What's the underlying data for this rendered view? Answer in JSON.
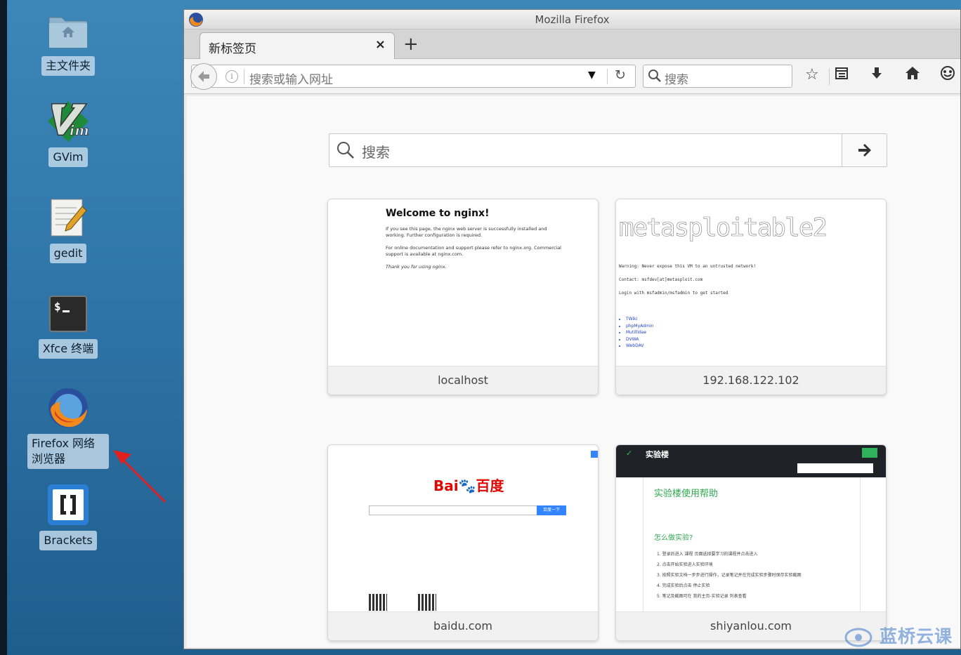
{
  "desktop": {
    "icons": [
      {
        "label": "主文件夹"
      },
      {
        "label": "GVim"
      },
      {
        "label": "gedit"
      },
      {
        "label": "Xfce 终端"
      },
      {
        "label": "Firefox 网络浏览器"
      },
      {
        "label": "Brackets"
      }
    ]
  },
  "window": {
    "title": "Mozilla Firefox"
  },
  "tab": {
    "label": "新标签页",
    "close": "×",
    "new_tab": "+"
  },
  "navbar": {
    "url_placeholder": "搜索或输入网址",
    "search_placeholder": "搜索"
  },
  "newtab": {
    "search_placeholder": "搜索",
    "tiles": [
      {
        "caption": "localhost"
      },
      {
        "caption": "192.168.122.102"
      },
      {
        "caption": "baidu.com"
      },
      {
        "caption": "shiyanlou.com"
      }
    ]
  },
  "thumb_nginx": {
    "title": "Welcome to nginx!",
    "p1": "If you see this page, the nginx web server is successfully installed and working. Further configuration is required.",
    "p2": "For online documentation and support please refer to nginx.org. Commercial support is available at nginx.com.",
    "p3": "Thank you for using nginx."
  },
  "thumb_meta": {
    "banner": "metasploitable2",
    "l1": "Warning: Never expose this VM to an untrusted network!",
    "l2": "Contact: msfdev[at]metasploit.com",
    "l3": "Login with msfadmin/msfadmin to get started",
    "links": [
      "TWiki",
      "phpMyAdmin",
      "Mutillidae",
      "DVWA",
      "WebDAV"
    ]
  },
  "thumb_baidu": {
    "logo_left": "Bai",
    "logo_mid": "du",
    "logo_right": "百度",
    "button": "百度一下"
  },
  "thumb_shiyanlou": {
    "brand": "实验楼",
    "heading": "实验楼使用帮助",
    "subheading": "怎么做实验?",
    "steps": [
      "1. 登录后进入 课程 页面选择要学习的课程并点击进入",
      "2. 点击开始实验进入实验环境",
      "3. 按照实验文档一步步进行操作，记录笔记并在完成实验步骤时保存实验截图",
      "4. 完成实验后点击 停止实验",
      "5. 笔记及截图可在 我的主页-实验记录 列表查看"
    ]
  },
  "watermark": "蓝桥云课",
  "colors": {
    "accent": "#2fa84f",
    "baidu_red": "#e10601",
    "baidu_blue": "#3385ff",
    "desktop": "#2f75a8"
  }
}
